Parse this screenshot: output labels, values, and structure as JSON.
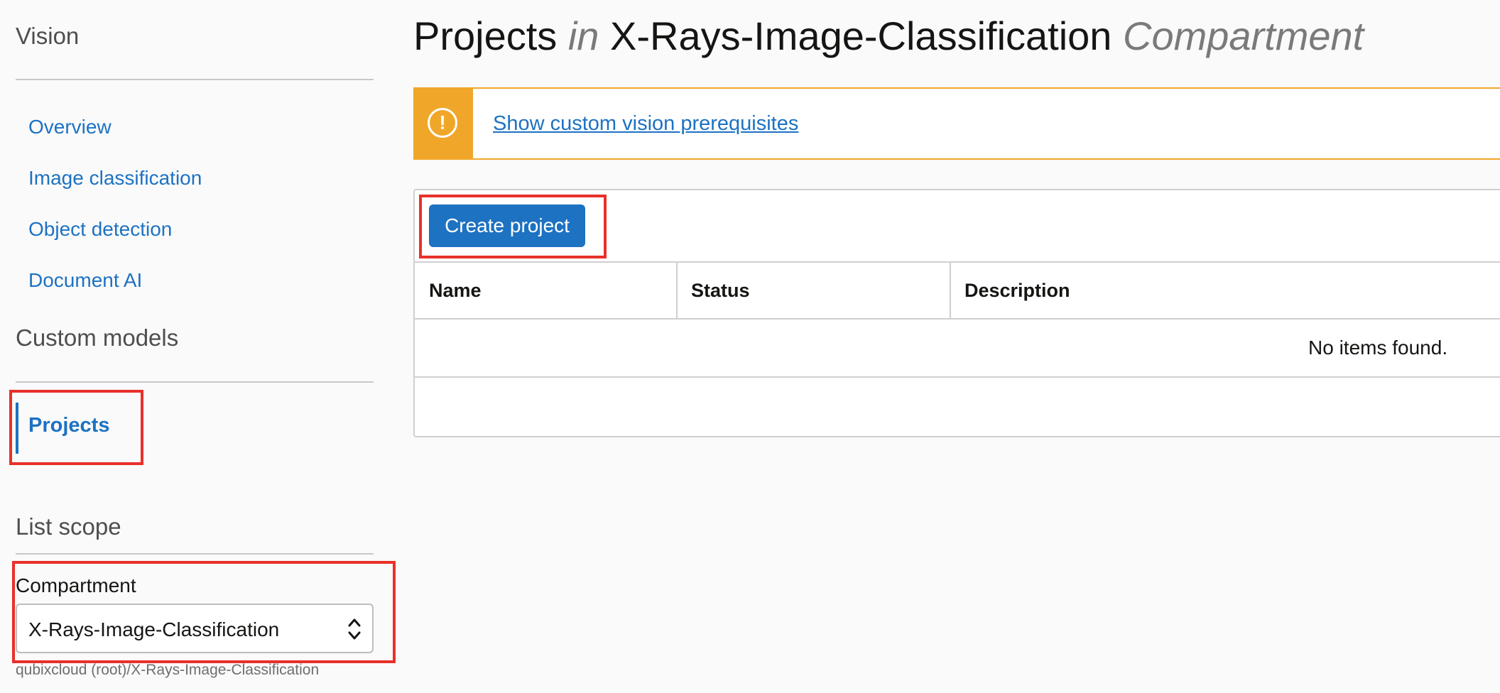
{
  "sidebar": {
    "service_title": "Vision",
    "nav_items": [
      "Overview",
      "Image classification",
      "Object detection",
      "Document AI"
    ],
    "custom_models_heading": "Custom models",
    "active_item": "Projects",
    "list_scope_heading": "List scope",
    "compartment": {
      "label": "Compartment",
      "selected_value": "X-Rays-Image-Classification",
      "path": "qubixcloud (root)/X-Rays-Image-Classification"
    }
  },
  "main": {
    "title": {
      "prefix": "Projects",
      "in_word": "in",
      "compartment_name": "X-Rays-Image-Classification",
      "suffix": "Compartment"
    },
    "banner": {
      "icon": "exclamation-circle-icon",
      "link_text": "Show custom vision prerequisites",
      "color": "#f0a729"
    },
    "create_button_label": "Create project",
    "table": {
      "columns": [
        "Name",
        "Status",
        "Description"
      ],
      "empty_message": "No items found."
    }
  },
  "colors": {
    "accent": "#1d72c2",
    "highlight_box": "#e8312a",
    "warning": "#f0a729"
  }
}
